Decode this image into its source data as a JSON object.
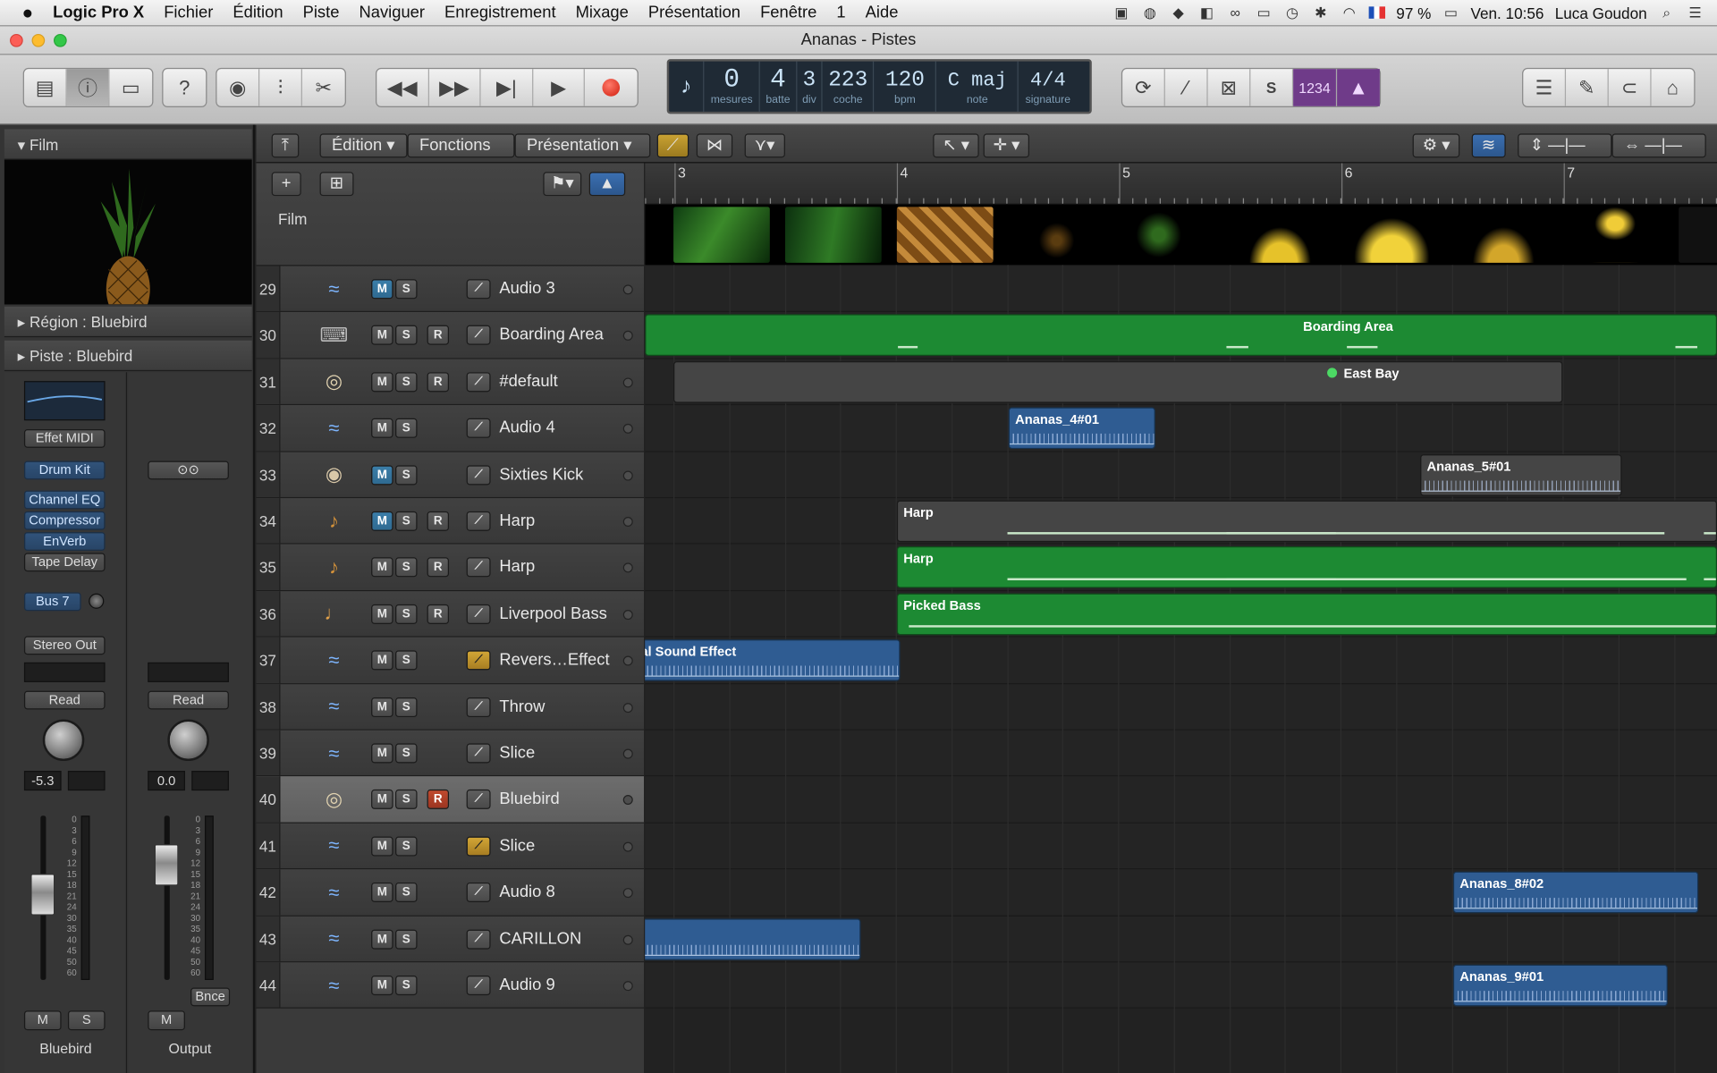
{
  "menubar": {
    "apple": "",
    "app": "Logic Pro X",
    "items": [
      "Fichier",
      "Édition",
      "Piste",
      "Naviguer",
      "Enregistrement",
      "Mixage",
      "Présentation",
      "Fenêtre",
      "1",
      "Aide"
    ],
    "battery": "97 %",
    "clock": "Ven. 10:56",
    "user": "Luca Goudon"
  },
  "window": {
    "title": "Ananas - Pistes"
  },
  "lcd": {
    "bar": "0",
    "beat": "4",
    "div": "3",
    "tick": "223",
    "tempo": "120",
    "key": "C maj",
    "signature": "4/4",
    "bar_label": "mesures",
    "beat_label": "batte",
    "div_label": "div",
    "tick_label": "coche",
    "tempo_label": "bpm",
    "key_label": "note",
    "signature_label": "signature",
    "counter": "1234"
  },
  "inspector": {
    "film_label": "Film",
    "region_label": "Région : Bluebird",
    "track_label": "Piste : Bluebird",
    "midi_fx": "Effet MIDI",
    "instrument": "Drum Kit",
    "plugins": [
      "Channel EQ",
      "Compressor",
      "EnVerb",
      "Tape Delay"
    ],
    "send": "Bus 7",
    "output": "Stereo Out",
    "read_left": "Read",
    "read_right": "Read",
    "vol_left": "-5.3",
    "vol_right": "0.0",
    "bounce": "Bnce",
    "m": "M",
    "s": "S",
    "strip_left_name": "Bluebird",
    "strip_right_name": "Output",
    "scale": [
      "0",
      "3",
      "6",
      "9",
      "12",
      "15",
      "18",
      "21",
      "24",
      "30",
      "35",
      "40",
      "45",
      "50",
      "60"
    ]
  },
  "tracks_header": {
    "edit": "Édition",
    "functions": "Fonctions",
    "view": "Présentation"
  },
  "global": {
    "film_track": "Film"
  },
  "ruler": {
    "bars": [
      "3",
      "4",
      "5",
      "6",
      "7"
    ]
  },
  "tracks": [
    {
      "num": "29",
      "name": "Audio 3",
      "icon": "audio-waveform-icon",
      "m_on": true,
      "r": false,
      "r_on": false,
      "yellow": false
    },
    {
      "num": "30",
      "name": "Boarding Area",
      "icon": "synth-keyboard-icon",
      "m_on": false,
      "r": true,
      "r_on": false,
      "yellow": false
    },
    {
      "num": "31",
      "name": "#default",
      "icon": "drum-kit-icon",
      "m_on": false,
      "r": true,
      "r_on": false,
      "yellow": false
    },
    {
      "num": "32",
      "name": "Audio 4",
      "icon": "audio-waveform-icon",
      "m_on": false,
      "r": false,
      "r_on": false,
      "yellow": false
    },
    {
      "num": "33",
      "name": "Sixties Kick",
      "icon": "kick-drum-icon",
      "m_on": true,
      "r": false,
      "r_on": false,
      "yellow": false
    },
    {
      "num": "34",
      "name": "Harp",
      "icon": "harp-icon",
      "m_on": true,
      "r": true,
      "r_on": false,
      "yellow": false
    },
    {
      "num": "35",
      "name": "Harp",
      "icon": "harp-icon",
      "m_on": false,
      "r": true,
      "r_on": false,
      "yellow": false
    },
    {
      "num": "36",
      "name": "Liverpool Bass",
      "icon": "bass-guitar-icon",
      "m_on": false,
      "r": true,
      "r_on": false,
      "yellow": false
    },
    {
      "num": "37",
      "name": "Revers…Effect",
      "icon": "audio-waveform-icon",
      "m_on": false,
      "r": false,
      "r_on": false,
      "yellow": true
    },
    {
      "num": "38",
      "name": "Throw",
      "icon": "audio-waveform-icon",
      "m_on": false,
      "r": false,
      "r_on": false,
      "yellow": false
    },
    {
      "num": "39",
      "name": "Slice",
      "icon": "audio-waveform-icon",
      "m_on": false,
      "r": false,
      "r_on": false,
      "yellow": false
    },
    {
      "num": "40",
      "name": "Bluebird",
      "icon": "drum-kit-icon",
      "m_on": false,
      "r": true,
      "r_on": true,
      "yellow": false,
      "selected": true
    },
    {
      "num": "41",
      "name": "Slice",
      "icon": "audio-waveform-icon",
      "m_on": false,
      "r": false,
      "r_on": false,
      "yellow": true
    },
    {
      "num": "42",
      "name": "Audio 8",
      "icon": "audio-waveform-icon",
      "m_on": false,
      "r": false,
      "r_on": false,
      "yellow": false
    },
    {
      "num": "43",
      "name": "CARILLON",
      "icon": "audio-waveform-icon",
      "m_on": false,
      "r": false,
      "r_on": false,
      "yellow": false
    },
    {
      "num": "44",
      "name": "Audio 9",
      "icon": "audio-waveform-icon",
      "m_on": false,
      "r": false,
      "r_on": false,
      "yellow": false
    }
  ],
  "regions": [
    {
      "lane": 1,
      "name": "Boarding Area",
      "color": "green"
    },
    {
      "lane": 2,
      "name": "East Bay",
      "color": "gray"
    },
    {
      "lane": 3,
      "name": "Ananas_4#01",
      "color": "blue"
    },
    {
      "lane": 4,
      "name": "Ananas_5#01",
      "color": "gray"
    },
    {
      "lane": 5,
      "name": "Harp",
      "color": "gray"
    },
    {
      "lane": 6,
      "name": "Harp",
      "color": "green"
    },
    {
      "lane": 7,
      "name": "Picked Bass",
      "color": "green"
    },
    {
      "lane": 8,
      "name": "al Sound Effect",
      "color": "blue"
    },
    {
      "lane": 13,
      "name": "Ananas_8#02",
      "color": "blue"
    },
    {
      "lane": 14,
      "name": "",
      "color": "blue"
    },
    {
      "lane": 15,
      "name": "Ananas_9#01",
      "color": "blue"
    }
  ],
  "colors": {
    "accent_blue": "#3b7ea9",
    "region_green": "#1d8a33",
    "region_blue": "#2f5c92",
    "record_red": "#c04a2e"
  }
}
